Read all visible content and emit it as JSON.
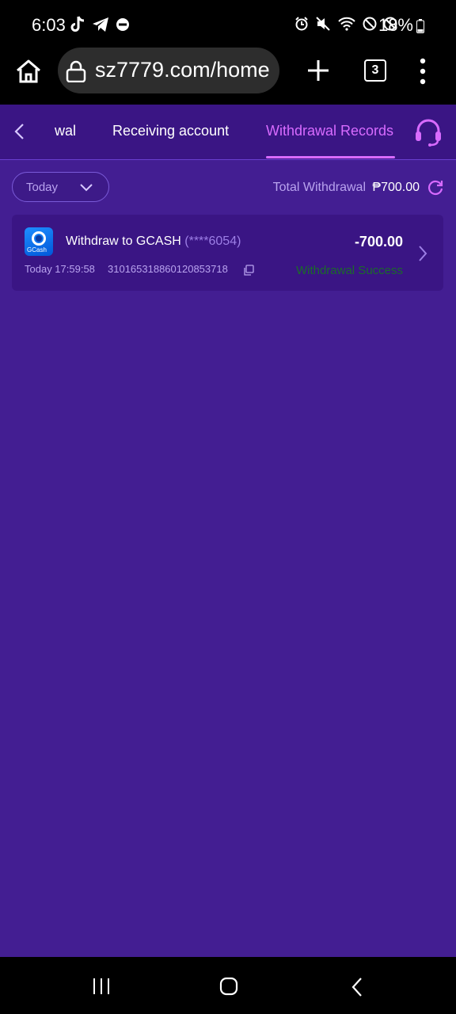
{
  "status_bar": {
    "time": "6:03",
    "battery": "18%",
    "left_icons": [
      "tiktok-icon",
      "telegram-icon",
      "dnd-icon"
    ],
    "right_icons": [
      "alarm-icon",
      "mute-icon",
      "wifi-icon",
      "blocked-icon",
      "blocked-icon"
    ]
  },
  "browser": {
    "url": "sz7779.com/home",
    "tab_count": "3",
    "icons": [
      "home-icon",
      "lock-icon",
      "plus-icon",
      "tabs-icon",
      "more-vertical-icon"
    ]
  },
  "app_nav": {
    "tabs": [
      {
        "label": "wal",
        "active": false
      },
      {
        "label": "Receiving account",
        "active": false
      },
      {
        "label": "Withdrawal Records",
        "active": true
      }
    ],
    "accent_color": "#d86bff",
    "icons": [
      "back-chevron-icon",
      "headset-support-icon"
    ]
  },
  "filter": {
    "date_value": "Today",
    "total_label": "Total Withdrawal",
    "total_value": "₱700.00"
  },
  "records": [
    {
      "title": "Withdraw to GCASH",
      "masked_account": "(****6054)",
      "amount": "-700.00",
      "time": "Today 17:59:58",
      "order_no": "310165318860120853718",
      "status": "Withdrawal Success",
      "logo_text": "GCash",
      "status_color": "#1b6b2a"
    }
  ],
  "colors": {
    "background": "#431e92",
    "nav_background": "#3a1584"
  }
}
